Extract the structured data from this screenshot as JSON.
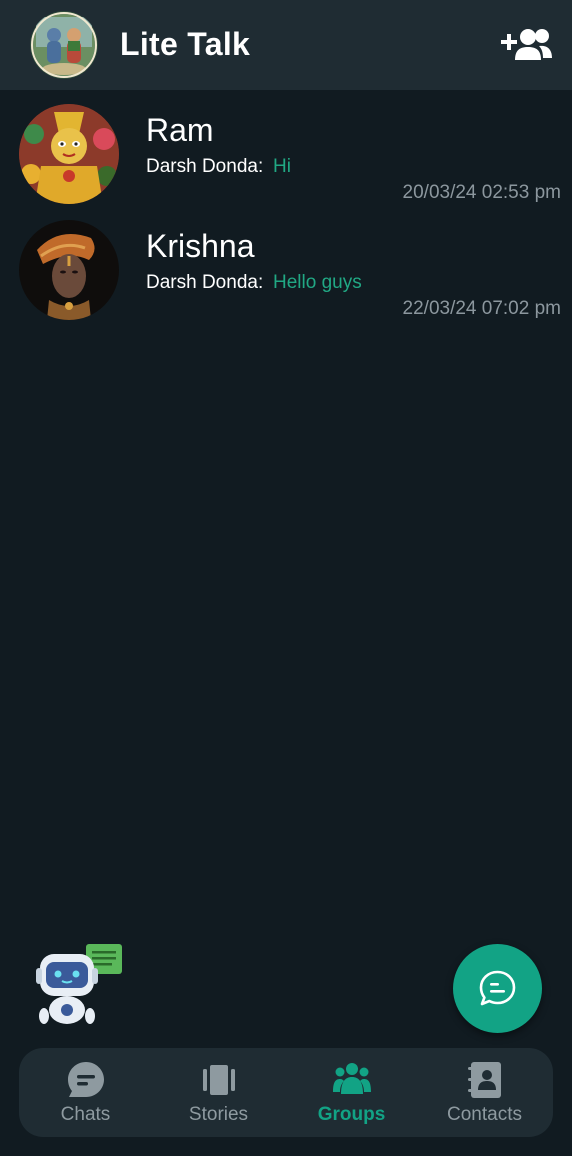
{
  "app": {
    "title": "Lite Talk"
  },
  "header": {
    "profile_avatar_icon": "deity-couple-avatar",
    "add_group_icon": "add-group-icon"
  },
  "groups": [
    {
      "name": "Ram",
      "sender": "Darsh Donda:",
      "message": "Hi",
      "time": "20/03/24 02:53 pm",
      "avatar_icon": "ram-deity-avatar"
    },
    {
      "name": "Krishna",
      "sender": "Darsh Donda:",
      "message": "Hello guys",
      "time": "22/03/24 07:02 pm",
      "avatar_icon": "krishna-avatar"
    }
  ],
  "bot": {
    "icon": "robot-chat-icon"
  },
  "fab": {
    "icon": "new-chat-icon"
  },
  "nav": {
    "items": [
      {
        "label": "Chats",
        "icon": "chat-bubble-icon",
        "active": false
      },
      {
        "label": "Stories",
        "icon": "stories-icon",
        "active": false
      },
      {
        "label": "Groups",
        "icon": "groups-icon",
        "active": true
      },
      {
        "label": "Contacts",
        "icon": "contacts-icon",
        "active": false
      }
    ]
  },
  "colors": {
    "background": "#111b21",
    "bar": "#1f2c33",
    "accent": "#12a385",
    "message_text": "#21a884",
    "muted": "#8c979e"
  }
}
